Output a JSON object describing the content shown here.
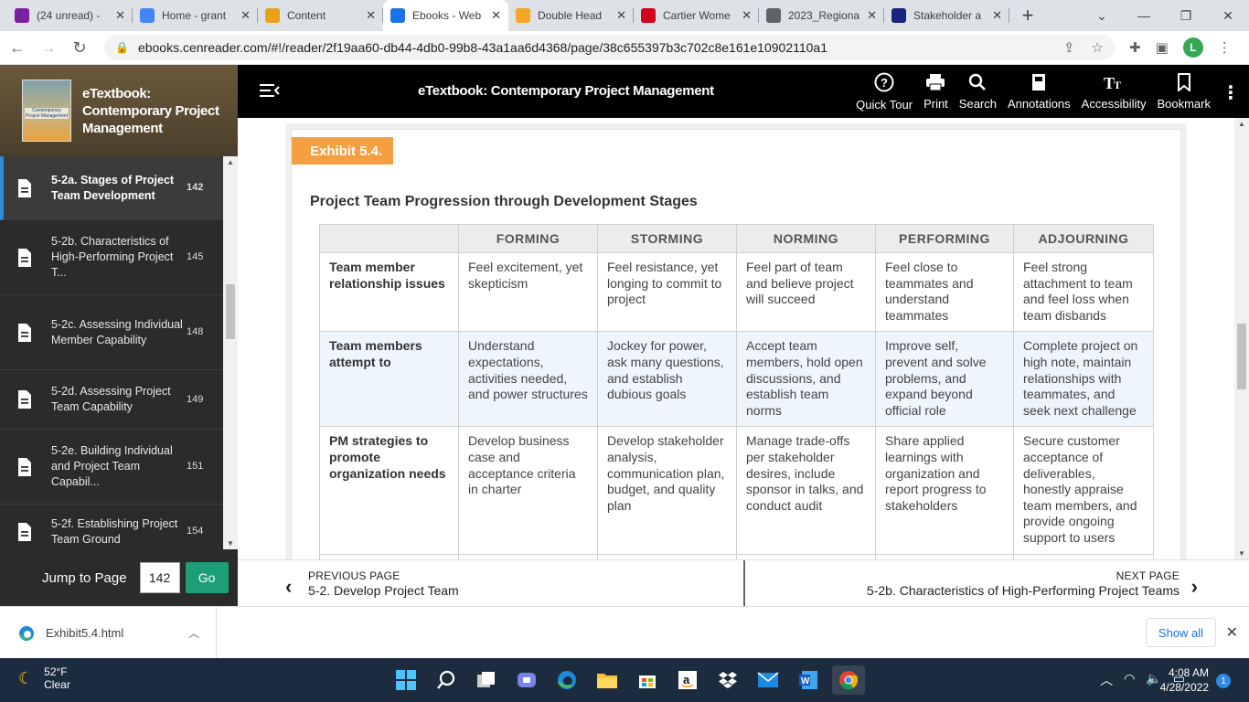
{
  "browser": {
    "tabs": [
      {
        "title": "(24 unread) -",
        "icon": "mail-icon",
        "color": "#7b1fa2",
        "active": false
      },
      {
        "title": "Home - grant",
        "icon": "g-icon",
        "color": "#4285f4",
        "active": false
      },
      {
        "title": "Content",
        "icon": "pencil-icon",
        "color": "#e8a21a",
        "active": false
      },
      {
        "title": "Ebooks - Web",
        "icon": "book-icon",
        "color": "#1a73e8",
        "active": true
      },
      {
        "title": "Double Head",
        "icon": "sun-icon",
        "color": "#f5a623",
        "active": false
      },
      {
        "title": "Cartier Wome",
        "icon": "cwi-icon",
        "color": "#d0021b",
        "active": false
      },
      {
        "title": "2023_Regiona",
        "icon": "globe-icon",
        "color": "#5f6368",
        "active": false
      },
      {
        "title": "Stakeholder a",
        "icon": "circle-icon",
        "color": "#1a237e",
        "active": false
      }
    ],
    "url": "ebooks.cenreader.com/#!/reader/2f19aa60-db44-4db0-99b8-43a1aa6d4368/page/38c655397b3c702c8e161e10902110a1",
    "profile_initial": "L"
  },
  "sidebar": {
    "book_title": "eTextbook: Contemporary Project Management",
    "cover_text": "Contemporary Project Management",
    "toc": [
      {
        "label": "5-2a. Stages of Project Team Development",
        "page": "142",
        "active": true
      },
      {
        "label": "5-2b. Characteristics of High-Performing Project T...",
        "page": "145",
        "active": false
      },
      {
        "label": "5-2c. Assessing Individual Member Capability",
        "page": "148",
        "active": false
      },
      {
        "label": "5-2d. Assessing Project Team Capability",
        "page": "149",
        "active": false
      },
      {
        "label": "5-2e. Building Individual and Project Team Capabil...",
        "page": "151",
        "active": false
      },
      {
        "label": "5-2f. Establishing Project Team Ground",
        "page": "154",
        "active": false
      }
    ],
    "jump_label": "Jump to Page",
    "jump_value": "142",
    "go_label": "Go"
  },
  "reader": {
    "title": "eTextbook: Contemporary Project Management",
    "tools": [
      {
        "label": "Quick Tour",
        "icon": "help-circle-icon"
      },
      {
        "label": "Print",
        "icon": "printer-icon"
      },
      {
        "label": "Search",
        "icon": "search-icon"
      },
      {
        "label": "Annotations",
        "icon": "annotation-icon"
      },
      {
        "label": "Accessibility",
        "icon": "text-size-icon"
      },
      {
        "label": "Bookmark",
        "icon": "bookmark-icon"
      }
    ]
  },
  "exhibit": {
    "tag": "Exhibit 5.4.",
    "title": "Project Team Progression through Development Stages",
    "columns": [
      "",
      "FORMING",
      "STORMING",
      "NORMING",
      "PERFORMING",
      "ADJOURNING"
    ],
    "rows": [
      {
        "header": "Team member relationship issues",
        "cells": [
          "Feel excitement, yet skepticism",
          "Feel resistance, yet longing to commit to project",
          "Feel part of team and believe project will succeed",
          "Feel close to teammates and understand teammates",
          "Feel strong attachment to team and feel loss when team disbands"
        ]
      },
      {
        "header": "Team members attempt to",
        "cells": [
          "Understand expectations, activities needed, and power structures",
          "Jockey for power, ask many questions, and establish dubious goals",
          "Accept team members, hold open discussions, and establish team norms",
          "Improve self, prevent and solve problems, and expand beyond official role",
          "Complete project on high note, maintain relationships with teammates, and seek next challenge"
        ]
      },
      {
        "header": "PM strategies to promote organization needs",
        "cells": [
          "Develop business case and acceptance criteria in charter",
          "Develop stakeholder analysis, communication plan, budget, and quality plan",
          "Manage trade-offs per stakeholder desires, include sponsor in talks, and conduct audit",
          "Share applied learnings with organization and report progress to stakeholders",
          "Secure customer acceptance of deliverables, honestly appraise team members, and provide ongoing support to users"
        ]
      }
    ]
  },
  "pager": {
    "prev_label": "PREVIOUS PAGE",
    "prev_title": "5-2. Develop Project Team",
    "next_label": "NEXT PAGE",
    "next_title": "5-2b. Characteristics of High-Performing Project Teams"
  },
  "download": {
    "filename": "Exhibit5.4.html",
    "show_all": "Show all"
  },
  "taskbar": {
    "temp": "52°F",
    "condition": "Clear",
    "time": "4:08 AM",
    "date": "4/28/2022",
    "notifications": "1"
  }
}
